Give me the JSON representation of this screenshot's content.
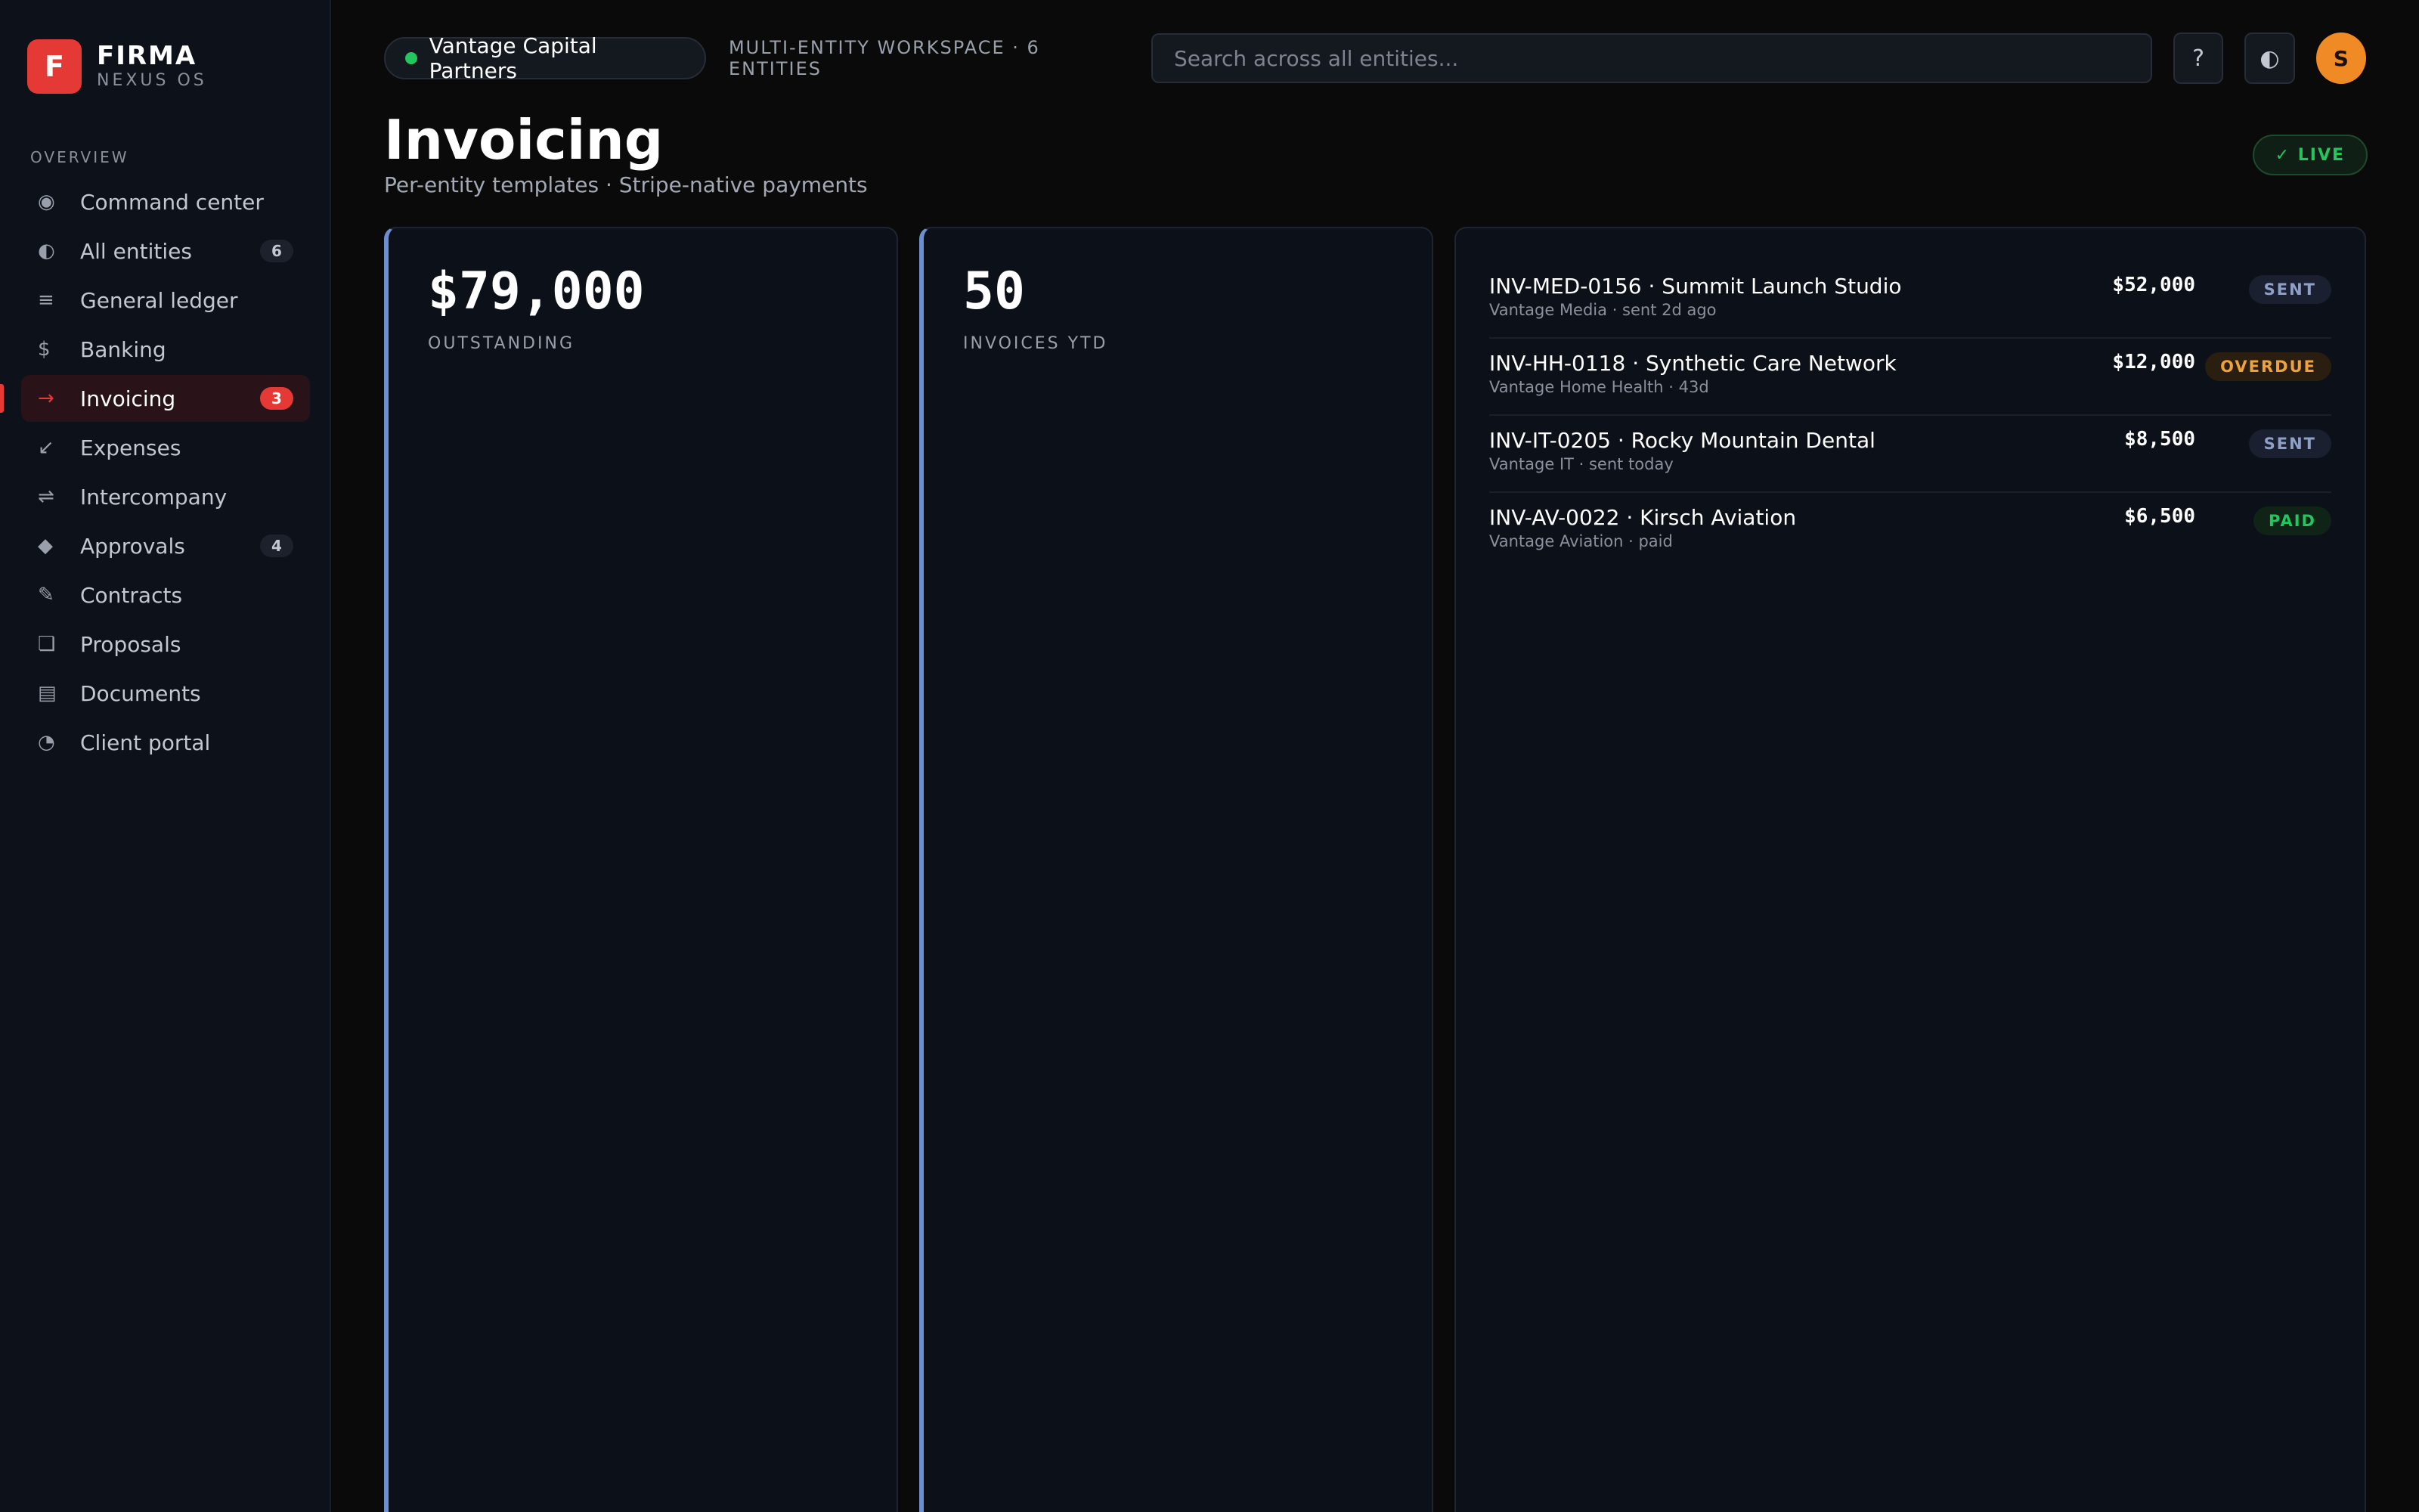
{
  "brand": {
    "logo_letter": "F",
    "name": "FIRMA",
    "subtitle": "NEXUS OS"
  },
  "sidebar": {
    "section_label": "OVERVIEW",
    "items": [
      {
        "icon": "target-icon",
        "glyph": "◉",
        "label": "Command center",
        "badge": ""
      },
      {
        "icon": "half-circle-icon",
        "glyph": "◐",
        "label": "All entities",
        "badge": "6"
      },
      {
        "icon": "ledger-icon",
        "glyph": "≡",
        "label": "General ledger",
        "badge": ""
      },
      {
        "icon": "dollar-icon",
        "glyph": "$",
        "label": "Banking",
        "badge": ""
      },
      {
        "icon": "arrow-right-icon",
        "glyph": "→",
        "label": "Invoicing",
        "badge": "3",
        "active": true
      },
      {
        "icon": "arrow-down-left-icon",
        "glyph": "↙",
        "label": "Expenses",
        "badge": ""
      },
      {
        "icon": "swap-icon",
        "glyph": "⇌",
        "label": "Intercompany",
        "badge": ""
      },
      {
        "icon": "diamond-icon",
        "glyph": "◆",
        "label": "Approvals",
        "badge": "4"
      },
      {
        "icon": "pencil-icon",
        "glyph": "✎",
        "label": "Contracts",
        "badge": ""
      },
      {
        "icon": "square-icon",
        "glyph": "❏",
        "label": "Proposals",
        "badge": ""
      },
      {
        "icon": "document-icon",
        "glyph": "▤",
        "label": "Documents",
        "badge": ""
      },
      {
        "icon": "portal-icon",
        "glyph": "◔",
        "label": "Client portal",
        "badge": ""
      }
    ]
  },
  "topbar": {
    "entity_name": "Vantage Capital Partners",
    "workspace_label": "MULTI-ENTITY WORKSPACE · 6 ENTITIES",
    "search_placeholder": "Search across all entities...",
    "help_glyph": "?",
    "theme_glyph": "◐",
    "avatar_initial": "S"
  },
  "page": {
    "title": "Invoicing",
    "subtitle": "Per-entity templates · Stripe-native payments",
    "live_badge": "✓ LIVE"
  },
  "stats": [
    {
      "value": "$79,000",
      "label": "OUTSTANDING"
    },
    {
      "value": "50",
      "label": "INVOICES YTD"
    }
  ],
  "invoices": [
    {
      "title": "INV-MED-0156 · Summit Launch Studio",
      "sub": "Vantage Media · sent 2d ago",
      "amount": "$52,000",
      "status": "SENT",
      "status_class": "st-sent"
    },
    {
      "title": "INV-HH-0118 · Synthetic Care Network",
      "sub": "Vantage Home Health · 43d",
      "amount": "$12,000",
      "status": "OVERDUE",
      "status_class": "st-overdue"
    },
    {
      "title": "INV-IT-0205 · Rocky Mountain Dental",
      "sub": "Vantage IT · sent today",
      "amount": "$8,500",
      "status": "SENT",
      "status_class": "st-sent"
    },
    {
      "title": "INV-AV-0022 · Kirsch Aviation",
      "sub": "Vantage Aviation · paid",
      "amount": "$6,500",
      "status": "PAID",
      "status_class": "st-paid"
    }
  ],
  "colors": {
    "accent": "#e53935",
    "stat_border": "#6d8fd0",
    "live_green": "#22c55e",
    "overdue": "#f0a23a",
    "avatar": "#f08a24"
  }
}
